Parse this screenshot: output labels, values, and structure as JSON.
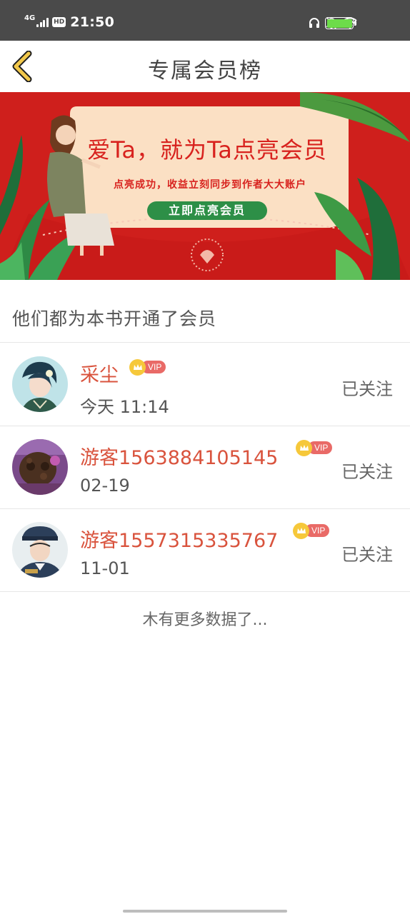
{
  "status_bar": {
    "network": "4G",
    "hd": "HD",
    "time": "21:50",
    "icons": [
      "headphones-icon",
      "mute-bell-icon",
      "wifi-icon",
      "battery-icon"
    ],
    "battery_level": 1.0
  },
  "nav": {
    "back_icon": "chevron-left-icon",
    "title": "专属会员榜"
  },
  "banner": {
    "headline": "爱Ta，就为Ta点亮会员",
    "subtitle": "点亮成功，收益立刻同步到作者大大账户",
    "cta": "立即点亮会员",
    "colors": {
      "background": "#cf1f1c",
      "card": "#fbe0c4",
      "button": "#2d8f47"
    }
  },
  "section": {
    "title": "他们都为本书开通了会员"
  },
  "members": [
    {
      "name": "采尘",
      "vip": "VIP",
      "time": "今天 11:14",
      "follow": "已关注"
    },
    {
      "name": "游客1563884105145",
      "vip": "VIP",
      "time": "02-19",
      "follow": "已关注"
    },
    {
      "name": "游客1557315335767",
      "vip": "VIP",
      "time": "11-01",
      "follow": "已关注"
    }
  ],
  "footer": {
    "no_more": "木有更多数据了..."
  },
  "colors": {
    "accent_name": "#d9533d",
    "vip_badge": "#e96a67",
    "crown": "#f6c83a"
  }
}
